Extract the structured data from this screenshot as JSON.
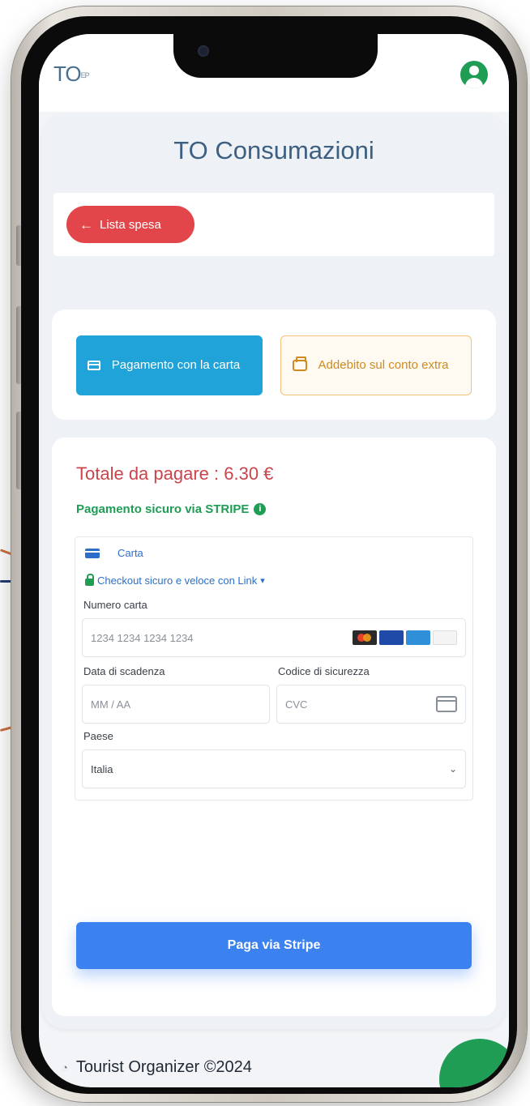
{
  "header": {
    "logo_main": "TO",
    "logo_small": "EP",
    "avatar_icon": "user-circle-icon"
  },
  "page": {
    "title": "TO Consumazioni"
  },
  "nav": {
    "back_label": "Lista spesa",
    "back_icon": "arrow-left-icon"
  },
  "payment_methods": {
    "card_label": "Pagamento con la carta",
    "account_label": "Addebito sul conto extra",
    "card_icon": "credit-card-icon",
    "account_icon": "wallet-icon"
  },
  "summary": {
    "total_label": "Totale da pagare : 6.30 €",
    "secure_label": "Pagamento sicuro via STRIPE",
    "secure_icon": "info-icon"
  },
  "stripe_form": {
    "tab_label": "Carta",
    "link_label": "Checkout sicuro e veloce con Link",
    "card_number_label": "Numero carta",
    "card_number_placeholder": "1234 1234 1234 1234",
    "expiry_label": "Data di scadenza",
    "expiry_placeholder": "MM / AA",
    "cvc_label": "Codice di sicurezza",
    "cvc_placeholder": "CVC",
    "country_label": "Paese",
    "country_value": "Italia",
    "brand_colors": [
      "#2a2a2a",
      "#1f4aa8",
      "#2f8fd8",
      "#f4f4f4"
    ]
  },
  "actions": {
    "submit_label": "Paga via Stripe"
  },
  "footer": {
    "text": "Tourist Organizer ©2024"
  },
  "colors": {
    "primary_blue": "#3b82f0",
    "danger": "#e3464a",
    "success": "#1f9d55",
    "card_blue": "#1fa3d8",
    "warning": "#d08a1e"
  }
}
